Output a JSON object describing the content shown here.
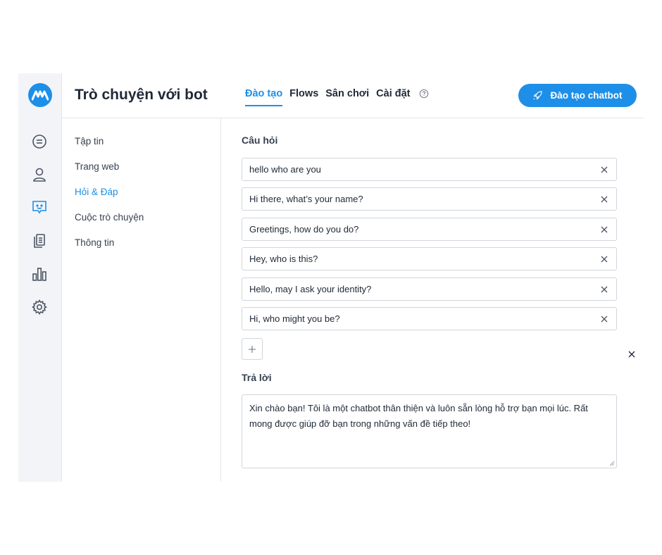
{
  "header": {
    "title": "Trò chuyện với bot",
    "tabs": [
      {
        "label": "Đào tạo",
        "active": true
      },
      {
        "label": "Flows",
        "active": false
      },
      {
        "label": "Sân chơi",
        "active": false
      },
      {
        "label": "Cài đặt",
        "active": false
      }
    ],
    "train_button_label": "Đào tạo chatbot"
  },
  "rail": {
    "icons": [
      "chat-bubble-icon",
      "user-icon",
      "bot-message-icon",
      "documents-icon",
      "bar-chart-icon",
      "gear-icon"
    ],
    "active_index": 2
  },
  "subnav": {
    "items": [
      {
        "label": "Tập tin",
        "active": false
      },
      {
        "label": "Trang web",
        "active": false
      },
      {
        "label": "Hỏi & Đáp",
        "active": true
      },
      {
        "label": "Cuộc trò chuyện",
        "active": false
      },
      {
        "label": "Thông tin",
        "active": false
      }
    ]
  },
  "main": {
    "questions_label": "Câu hỏi",
    "questions": [
      "hello who are you",
      "Hi there, what’s your name?",
      "Greetings, how do you do?",
      "Hey, who is this?",
      "Hello, may I ask your identity?",
      "Hi, who might you be?"
    ],
    "answer_label": "Trả lời",
    "answer_text": "Xin chào bạn! Tôi là một chatbot thân thiện và luôn sẵn lòng hỗ trợ bạn mọi lúc. Rất mong được giúp đỡ bạn trong những vấn đề tiếp theo!"
  },
  "colors": {
    "accent": "#1d8fe8",
    "rail_bg": "#f3f4f8",
    "border": "#d1d5db"
  }
}
